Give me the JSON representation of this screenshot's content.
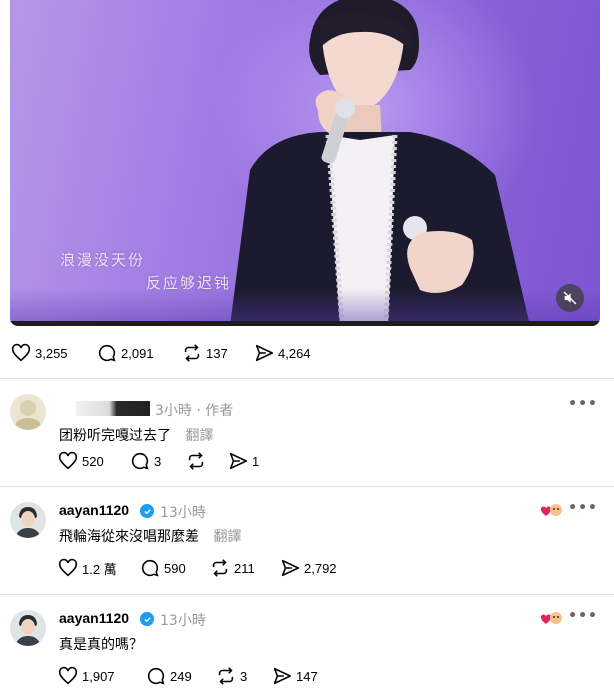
{
  "video": {
    "lyric_line_1": "浪漫没天份",
    "lyric_line_2": "反应够迟钝",
    "progress_fraction": 1.0,
    "icon": "mute-icon"
  },
  "post_actions": {
    "likes": "3,255",
    "replies": "2,091",
    "reposts": "137",
    "shares": "4,264"
  },
  "comments": [
    {
      "username": "",
      "time": "3小時",
      "author_tag": "· 作者",
      "text": "团粉听完嘎过去了",
      "translate": "翻譯",
      "likes": "520",
      "replies": "3",
      "reposts": "",
      "shares": "1"
    },
    {
      "username": "aayan1120",
      "time": "13小時",
      "author_tag": "",
      "text": "飛輪海從來沒唱那麼差",
      "translate": "翻譯",
      "likes": "1.2 萬",
      "replies": "590",
      "reposts": "211",
      "shares": "2,792"
    },
    {
      "username": "aayan1120",
      "time": "13小時",
      "author_tag": "",
      "text": "真是真的嗎？",
      "translate": "",
      "likes": "1,907",
      "replies": "249",
      "reposts": "3",
      "shares": "147"
    }
  ],
  "more_label": "•••",
  "colors": {
    "text": "#000000",
    "meta": "#999999",
    "verified": "#1d9bf0",
    "divider": "#e2e2e2"
  }
}
